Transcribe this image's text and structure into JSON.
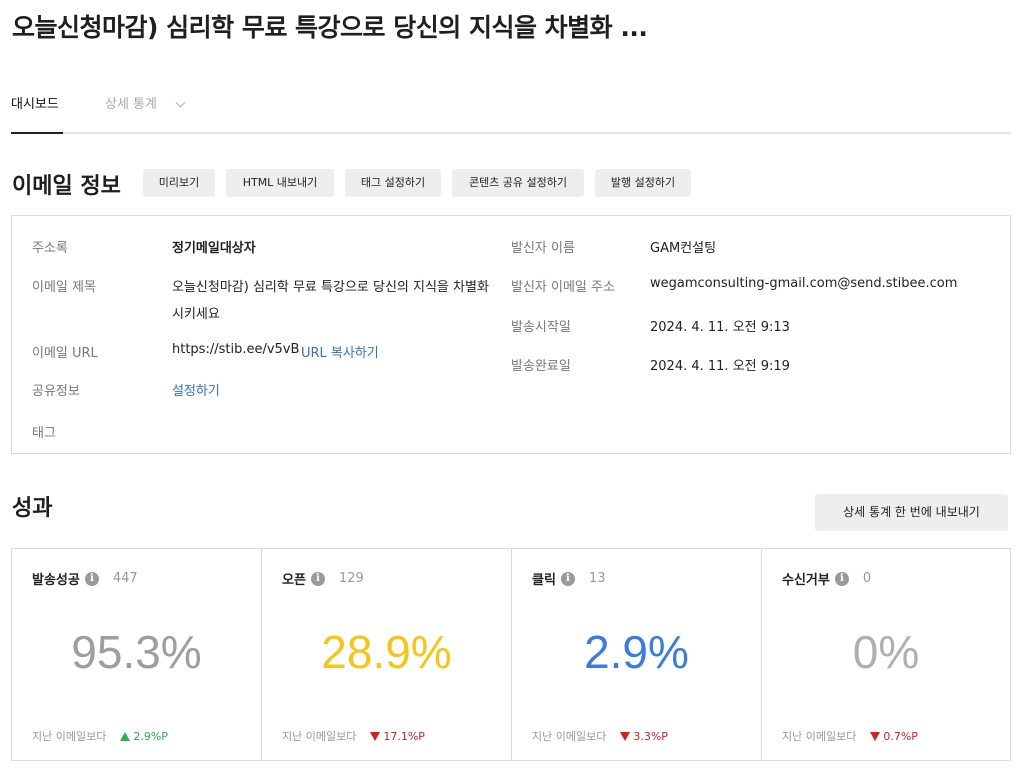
{
  "page": {
    "title": "오늘신청마감) 심리학 무료 특강으로 당신의 지식을 차별화 ..."
  },
  "tabs": {
    "dashboard": "대시보드",
    "detail_stats": "상세 통계"
  },
  "email_info": {
    "section_title": "이메일 정보",
    "buttons": {
      "preview": "미리보기",
      "html_export": "HTML 내보내기",
      "tag_settings": "태그 설정하기",
      "content_share": "콘텐츠 공유 설정하기",
      "publish_settings": "발행 설정하기"
    },
    "fields": {
      "address_book_label": "주소록",
      "address_book_value": "정기메일대상자",
      "subject_label": "이메일 제목",
      "subject_line1": "오늘신청마감) 심리학 무료 특강으로 당신의 지식을 차별화",
      "subject_line2": "시키세요",
      "url_label": "이메일 URL",
      "url_value": "https://stib.ee/v5vB",
      "url_copy": "URL 복사하기",
      "share_label": "공유정보",
      "share_link": "설정하기",
      "tag_label": "태그",
      "sender_name_label": "발신자 이름",
      "sender_name_value": "GAM컨설팅",
      "sender_email_label": "발신자 이메일 주소",
      "sender_email_value": "wegamconsulting-gmail.com@send.stibee.com",
      "send_start_label": "발송시작일",
      "send_start_value": "2024. 4. 11. 오전 9:13",
      "send_end_label": "발송완료일",
      "send_end_value": "2024. 4. 11. 오전 9:19"
    }
  },
  "performance": {
    "section_title": "성과",
    "export_button": "상세 통계 한 번에 내보내기",
    "compare_label": "지난 이메일보다",
    "cards": [
      {
        "label": "발송성공",
        "count": "447",
        "percent": "95.3%",
        "color": "#9e9e9e",
        "trend": "up",
        "delta": "2.9%P",
        "delta_color": "#27b24a"
      },
      {
        "label": "오픈",
        "count": "129",
        "percent": "28.9%",
        "color": "#f5c518",
        "trend": "down",
        "delta": "17.1%P",
        "delta_color": "#d61f1f"
      },
      {
        "label": "클릭",
        "count": "13",
        "percent": "2.9%",
        "color": "#3b7ddd",
        "trend": "down",
        "delta": "3.3%P",
        "delta_color": "#d61f1f"
      },
      {
        "label": "수신거부",
        "count": "0",
        "percent": "0%",
        "color": "#b0b0b0",
        "trend": "down",
        "delta": "0.7%P",
        "delta_color": "#d61f1f"
      }
    ]
  }
}
